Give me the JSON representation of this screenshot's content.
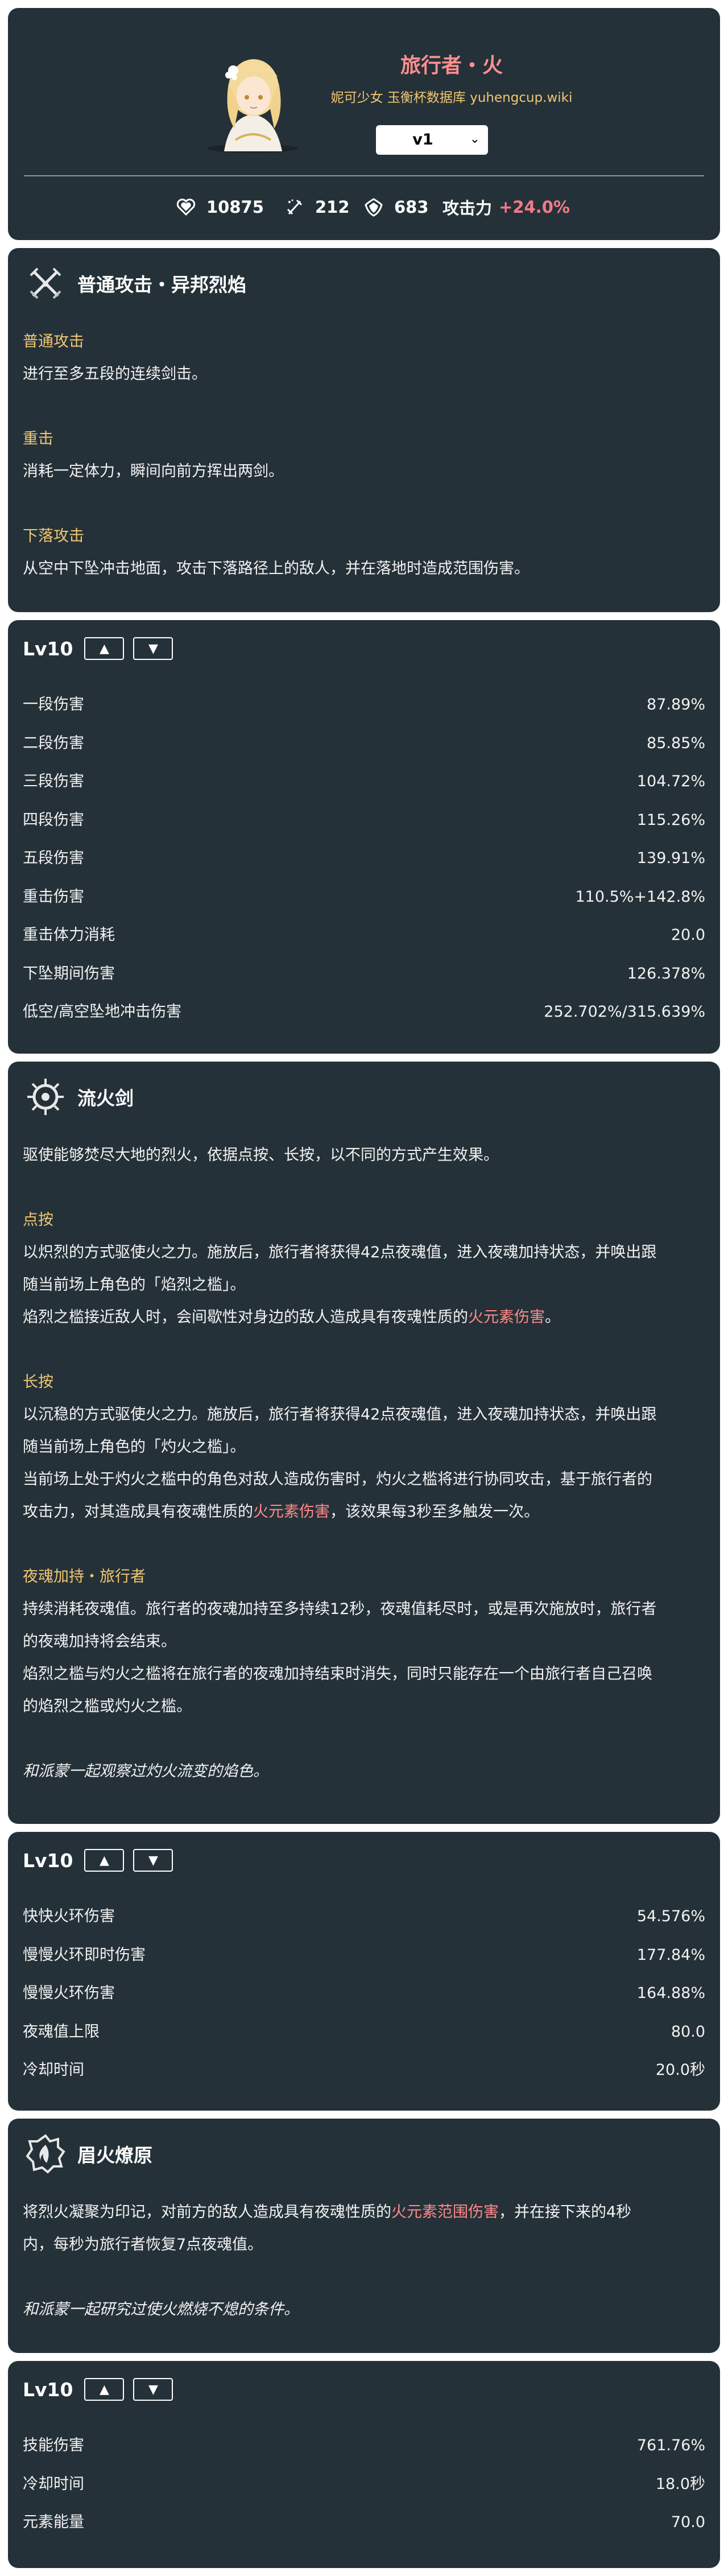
{
  "header": {
    "title": "旅行者・火",
    "subtitle": "妮可少女 玉衡杯数据库 yuhengcup.wiki",
    "version": "v1",
    "stats": {
      "hp": "10875",
      "atk": "212",
      "def": "683",
      "bonus_label": "攻击力",
      "bonus_value": "+24.0%"
    }
  },
  "normal_attack": {
    "name": "普通攻击・异邦烈焰",
    "sections": [
      {
        "title": "普通攻击",
        "text": "进行至多五段的连续剑击。"
      },
      {
        "title": "重击",
        "text": "消耗一定体力，瞬间向前方挥出两剑。"
      },
      {
        "title": "下落攻击",
        "text": "从空中下坠冲击地面，攻击下落路径上的敌人，并在落地时造成范围伤害。"
      }
    ]
  },
  "normal_attack_table": {
    "level": "Lv10",
    "up": "▲",
    "down": "▼",
    "rows": [
      {
        "label": "一段伤害",
        "value": "87.89%"
      },
      {
        "label": "二段伤害",
        "value": "85.85%"
      },
      {
        "label": "三段伤害",
        "value": "104.72%"
      },
      {
        "label": "四段伤害",
        "value": "115.26%"
      },
      {
        "label": "五段伤害",
        "value": "139.91%"
      },
      {
        "label": "重击伤害",
        "value": "110.5%+142.8%"
      },
      {
        "label": "重击体力消耗",
        "value": "20.0"
      },
      {
        "label": "下坠期间伤害",
        "value": "126.378%"
      },
      {
        "label": "低空/高空坠地冲击伤害",
        "value": "252.702%/315.639%"
      }
    ]
  },
  "skill": {
    "name": "流火剑",
    "intro": "驱使能够焚尽大地的烈火，依据点按、长按，以不同的方式产生效果。",
    "tap_title": "点按",
    "tap_1": "以炽烈的方式驱使火之力。施放后，旅行者将获得42点夜魂值，进入夜魂加持状态，并唤出跟",
    "tap_2": "随当前场上角色的「焰烈之槛」。",
    "tap_3": "焰烈之槛接近敌人时，会间歇性对身边的敌人造成具有夜魂性质的",
    "tap_3_hl": "火元素伤害",
    "tap_3_end": "。",
    "hold_title": "长按",
    "hold_1": "以沉稳的方式驱使火之力。施放后，旅行者将获得42点夜魂值，进入夜魂加持状态，并唤出跟",
    "hold_2": "随当前场上角色的「灼火之槛」。",
    "hold_3": "当前场上处于灼火之槛中的角色对敌人造成伤害时，灼火之槛将进行协同攻击，基于旅行者的",
    "hold_4": "攻击力，对其造成具有夜魂性质的",
    "hold_4_hl": "火元素伤害",
    "hold_4_end": "，该效果每3秒至多触发一次。",
    "night_title": "夜魂加持・旅行者",
    "night_1": "持续消耗夜魂值。旅行者的夜魂加持至多持续12秒，夜魂值耗尽时，或是再次施放时，旅行者",
    "night_2": "的夜魂加持将会结束。",
    "night_3": "焰烈之槛与灼火之槛将在旅行者的夜魂加持结束时消失，同时只能存在一个由旅行者自己召唤",
    "night_4": "的焰烈之槛或灼火之槛。",
    "flavor": "和派蒙一起观察过灼火流变的焰色。"
  },
  "skill_table": {
    "level": "Lv10",
    "up": "▲",
    "down": "▼",
    "rows": [
      {
        "label": "快快火环伤害",
        "value": "54.576%"
      },
      {
        "label": "慢慢火环即时伤害",
        "value": "177.84%"
      },
      {
        "label": "慢慢火环伤害",
        "value": "164.88%"
      },
      {
        "label": "夜魂值上限",
        "value": "80.0"
      },
      {
        "label": "冷却时间",
        "value": "20.0秒"
      }
    ]
  },
  "burst": {
    "name": "眉火燎原",
    "line1_a": "将烈火凝聚为印记，对前方的敌人造成具有夜魂性质的",
    "line1_hl": "火元素范围伤害",
    "line1_b": "，并在接下来的4秒",
    "line2": "内，每秒为旅行者恢复7点夜魂值。",
    "flavor": "和派蒙一起研究过使火燃烧不熄的条件。"
  },
  "burst_table": {
    "level": "Lv10",
    "up": "▲",
    "down": "▼",
    "rows": [
      {
        "label": "技能伤害",
        "value": "761.76%"
      },
      {
        "label": "冷却时间",
        "value": "18.0秒"
      },
      {
        "label": "元素能量",
        "value": "70.0"
      }
    ]
  },
  "icons": [
    "heart-icon",
    "sword-icon",
    "shield-icon",
    "normal-attack-icon",
    "skill-icon",
    "burst-icon",
    "avatar"
  ]
}
